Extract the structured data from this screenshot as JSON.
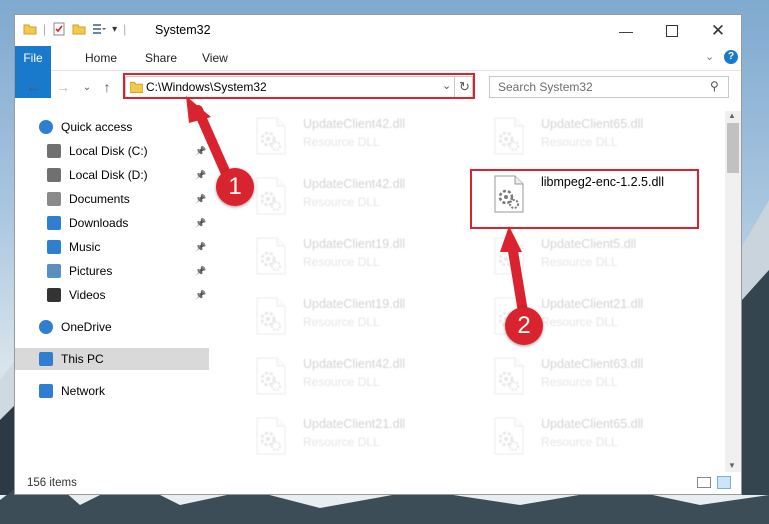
{
  "window": {
    "title": "System32",
    "controls": [
      "minimize-icon",
      "maximize-icon",
      "close-icon"
    ]
  },
  "ribbon": {
    "tabs": [
      "File",
      "Home",
      "Share",
      "View"
    ]
  },
  "address": {
    "path": "C:\\Windows\\System32"
  },
  "search": {
    "placeholder": "Search System32"
  },
  "sidebar": {
    "items": [
      {
        "label": "Quick access",
        "icon": "star-icon",
        "pinned": false
      },
      {
        "label": "Local Disk (C:)",
        "icon": "drive-icon",
        "pinned": true
      },
      {
        "label": "Local Disk (D:)",
        "icon": "drive-icon",
        "pinned": true
      },
      {
        "label": "Documents",
        "icon": "documents-icon",
        "pinned": true
      },
      {
        "label": "Downloads",
        "icon": "download-icon",
        "pinned": true
      },
      {
        "label": "Music",
        "icon": "music-icon",
        "pinned": true
      },
      {
        "label": "Pictures",
        "icon": "pictures-icon",
        "pinned": true
      },
      {
        "label": "Videos",
        "icon": "videos-icon",
        "pinned": true
      },
      {
        "label": "OneDrive",
        "icon": "cloud-icon",
        "pinned": false
      },
      {
        "label": "This PC",
        "icon": "computer-icon",
        "pinned": false,
        "selected": true
      },
      {
        "label": "Network",
        "icon": "network-icon",
        "pinned": false
      }
    ]
  },
  "files": {
    "left": [
      {
        "name": "UpdateClient42.dll",
        "type": "Resource DLL"
      },
      {
        "name": "UpdateClient42.dll",
        "type": "Resource DLL"
      },
      {
        "name": "UpdateClient19.dll",
        "type": "Resource DLL"
      },
      {
        "name": "UpdateClient19.dll",
        "type": "Resource DLL"
      },
      {
        "name": "UpdateClient42.dll",
        "type": "Resource DLL"
      },
      {
        "name": "UpdateClient21.dll",
        "type": "Resource DLL"
      }
    ],
    "right": [
      {
        "name": "UpdateClient65.dll",
        "type": "Resource DLL"
      },
      {
        "name": "libmpeg2-enc-1.2.5.dll",
        "type": ""
      },
      {
        "name": "UpdateClient5.dll",
        "type": "Resource DLL"
      },
      {
        "name": "UpdateClient21.dll",
        "type": "Resource DLL"
      },
      {
        "name": "UpdateClient63.dll",
        "type": "Resource DLL"
      },
      {
        "name": "UpdateClient65.dll",
        "type": "Resource DLL"
      }
    ]
  },
  "status": {
    "count": "156 items"
  },
  "annotations": {
    "badge1": "1",
    "badge2": "2",
    "color": "#d9232e"
  }
}
